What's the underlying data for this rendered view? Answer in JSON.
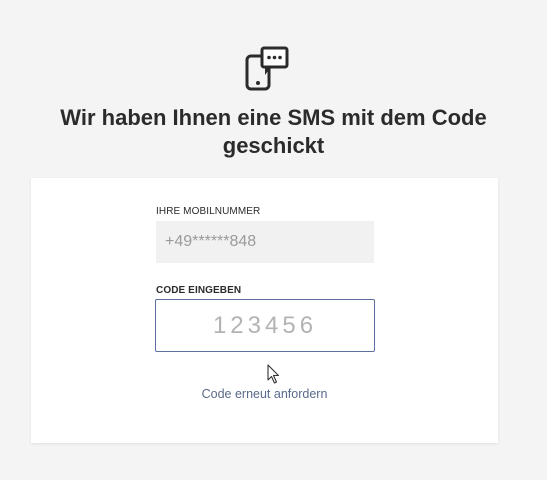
{
  "header": {
    "icon": "sms-phone-icon",
    "title": "Wir haben Ihnen eine SMS mit dem Code geschickt"
  },
  "form": {
    "phone_label": "IHRE MOBILNUMMER",
    "phone_value": "+49******848",
    "code_label": "CODE EINGEBEN",
    "code_placeholder": "123456",
    "code_value": "",
    "resend_link": "Code erneut anfordern"
  },
  "colors": {
    "background": "#f4f4f4",
    "card": "#ffffff",
    "input_border_focus": "#5d6f9f",
    "link": "#5a6a8a",
    "readonly_field": "#f1f1f1"
  }
}
